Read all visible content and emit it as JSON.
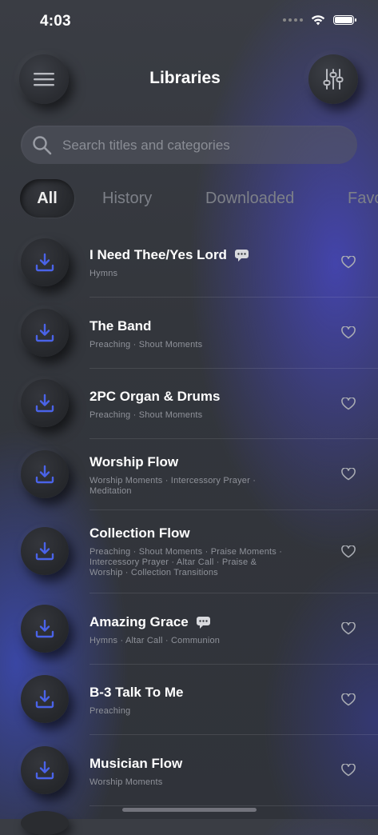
{
  "status": {
    "time": "4:03"
  },
  "header": {
    "title": "Libraries",
    "menu_icon": "hamburger-icon",
    "filter_icon": "sliders-icon"
  },
  "search": {
    "placeholder": "Search titles and categories",
    "value": ""
  },
  "tabs": [
    {
      "label": "All",
      "active": true
    },
    {
      "label": "History",
      "active": false
    },
    {
      "label": "Downloaded",
      "active": false
    },
    {
      "label": "Favo",
      "active": false
    }
  ],
  "items": [
    {
      "title": "I Need Thee/Yes Lord",
      "categories": "Hymns",
      "has_comment": true
    },
    {
      "title": "The Band",
      "categories": "Preaching · Shout Moments",
      "has_comment": false
    },
    {
      "title": "2PC Organ & Drums",
      "categories": "Preaching · Shout Moments",
      "has_comment": false
    },
    {
      "title": "Worship Flow",
      "categories": "Worship Moments · Intercessory Prayer · Meditation",
      "has_comment": false
    },
    {
      "title": "Collection Flow",
      "categories": "Preaching · Shout Moments · Praise Moments · Intercessory Prayer · Altar Call · Praise & Worship · Collection Transitions",
      "has_comment": false
    },
    {
      "title": "Amazing Grace",
      "categories": "Hymns · Altar Call · Communion",
      "has_comment": true
    },
    {
      "title": "B-3 Talk To Me",
      "categories": "Preaching",
      "has_comment": false
    },
    {
      "title": "Musician Flow",
      "categories": "Worship Moments",
      "has_comment": false
    }
  ],
  "colors": {
    "accent": "#4a63e8",
    "background": "#33363c",
    "muted_text": "#8f929a"
  }
}
